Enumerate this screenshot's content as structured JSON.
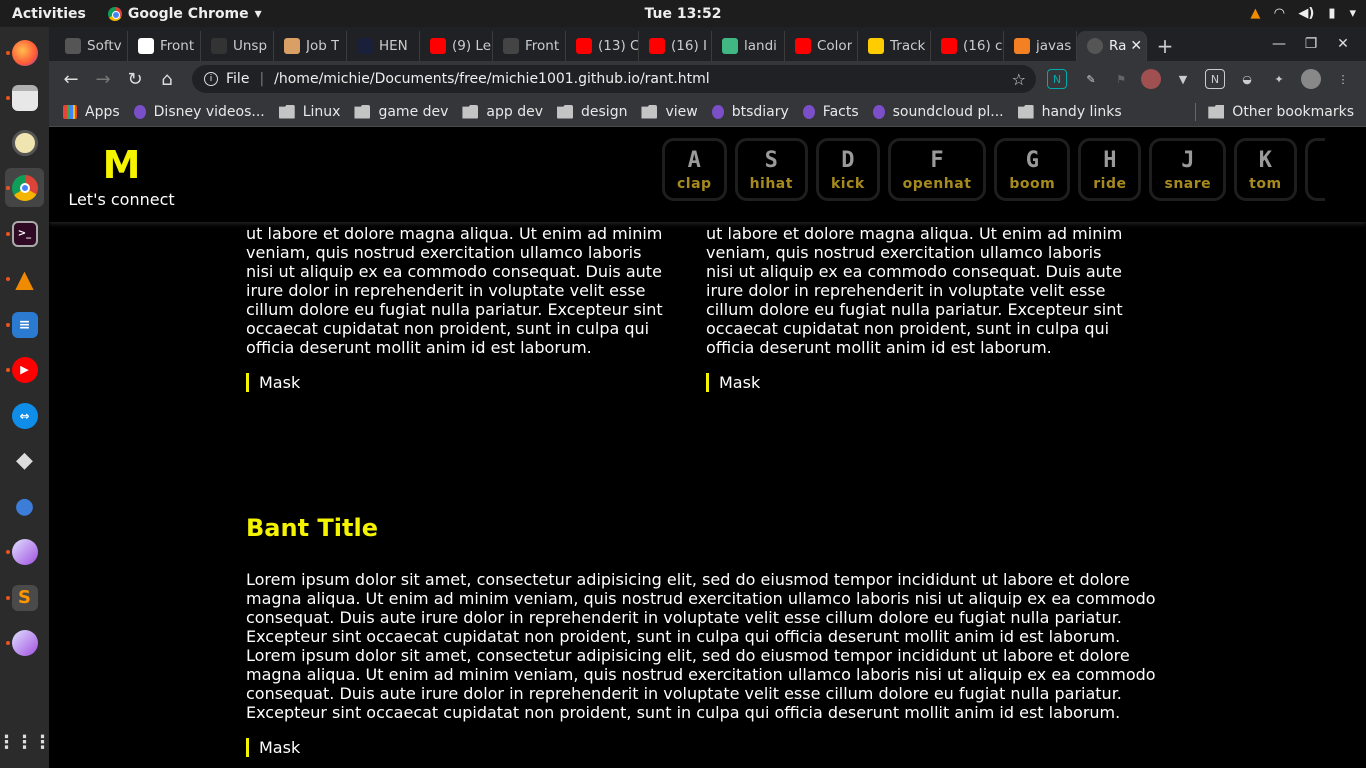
{
  "system": {
    "activities": "Activities",
    "app_menu": "Google Chrome",
    "clock": "Tue 13:52"
  },
  "browser": {
    "tabs": [
      {
        "label": "Softv",
        "icon": "globe-icon",
        "color": "#555555"
      },
      {
        "label": "Front",
        "icon": "notion-icon",
        "color": "#ffffff"
      },
      {
        "label": "Unsp",
        "icon": "unsplash-icon",
        "color": "#333333"
      },
      {
        "label": "Job T",
        "icon": "hand-icon",
        "color": "#d9a066"
      },
      {
        "label": "HEN",
        "icon": "henry-icon",
        "color": "#1a1f3a"
      },
      {
        "label": "(9) Le",
        "icon": "youtube-icon",
        "color": "#ff0000"
      },
      {
        "label": "Front",
        "icon": "grad-cap-icon",
        "color": "#444444"
      },
      {
        "label": "(13) C",
        "icon": "youtube-icon",
        "color": "#ff0000"
      },
      {
        "label": "(16) I",
        "icon": "youtube-icon",
        "color": "#ff0000"
      },
      {
        "label": "landi",
        "icon": "vue-icon",
        "color": "#41b883"
      },
      {
        "label": "Color",
        "icon": "adobe-icon",
        "color": "#ff0000"
      },
      {
        "label": "Track",
        "icon": "dhl-icon",
        "color": "#ffcc00"
      },
      {
        "label": "(16) c",
        "icon": "youtube-icon",
        "color": "#ff0000"
      },
      {
        "label": "javas",
        "icon": "stackoverflow-icon",
        "color": "#f48024"
      }
    ],
    "active_tab": "Ra",
    "new_tab": "+",
    "url_prefix": "File",
    "url": "/home/michie/Documents/free/michie1001.github.io/rant.html",
    "bookmarks": [
      {
        "label": "Apps",
        "type": "apps"
      },
      {
        "label": "Disney videos...",
        "type": "page"
      },
      {
        "label": "Linux",
        "type": "folder"
      },
      {
        "label": "game dev",
        "type": "folder"
      },
      {
        "label": "app dev",
        "type": "folder"
      },
      {
        "label": "design",
        "type": "folder"
      },
      {
        "label": "view",
        "type": "folder"
      },
      {
        "label": "btsdiary",
        "type": "page"
      },
      {
        "label": "Facts",
        "type": "page"
      },
      {
        "label": "soundcloud pl...",
        "type": "page"
      },
      {
        "label": "handy links",
        "type": "folder"
      }
    ],
    "other_bookmarks": "Other bookmarks"
  },
  "site": {
    "logo": "M",
    "tagline": "Let's connect",
    "drum_keys": [
      {
        "key": "A",
        "sound": "clap"
      },
      {
        "key": "S",
        "sound": "hihat"
      },
      {
        "key": "D",
        "sound": "kick"
      },
      {
        "key": "F",
        "sound": "openhat"
      },
      {
        "key": "G",
        "sound": "boom"
      },
      {
        "key": "H",
        "sound": "ride"
      },
      {
        "key": "J",
        "sound": "snare"
      },
      {
        "key": "K",
        "sound": "tom"
      }
    ],
    "rant_left_text": "ut labore et dolore magna aliqua. Ut enim ad minim veniam, quis nostrud exercitation ullamco laboris nisi ut aliquip ex ea commodo consequat. Duis aute irure dolor in reprehenderit in voluptate velit esse cillum dolore eu fugiat nulla pariatur. Excepteur sint occaecat cupidatat non proident, sunt in culpa qui officia deserunt mollit anim id est laborum.",
    "rant_left_tag": "Mask",
    "rant_right_text": "ut labore et dolore magna aliqua. Ut enim ad minim veniam, quis nostrud exercitation ullamco laboris nisi ut aliquip ex ea commodo consequat. Duis aute irure dolor in reprehenderit in voluptate velit esse cillum dolore eu fugiat nulla pariatur. Excepteur sint occaecat cupidatat non proident, sunt in culpa qui officia deserunt mollit anim id est laborum.",
    "rant_right_tag": "Mask",
    "rant2_title": "Bant Title",
    "rant2_text": "Lorem ipsum dolor sit amet, consectetur adipisicing elit, sed do eiusmod tempor incididunt ut labore et dolore magna aliqua. Ut enim ad minim veniam, quis nostrud exercitation ullamco laboris nisi ut aliquip ex ea commodo consequat. Duis aute irure dolor in reprehenderit in voluptate velit esse cillum dolore eu fugiat nulla pariatur. Excepteur sint occaecat cupidatat non proident, sunt in culpa qui officia deserunt mollit anim id est laborum. Lorem ipsum dolor sit amet, consectetur adipisicing elit, sed do eiusmod tempor incididunt ut labore et dolore magna aliqua. Ut enim ad minim veniam, quis nostrud exercitation ullamco laboris nisi ut aliquip ex ea commodo consequat. Duis aute irure dolor in reprehenderit in voluptate velit esse cillum dolore eu fugiat nulla pariatur. Excepteur sint occaecat cupidatat non proident, sunt in culpa qui officia deserunt mollit anim id est laborum.",
    "rant2_tag": "Mask",
    "accent_color": "#f4f400"
  }
}
